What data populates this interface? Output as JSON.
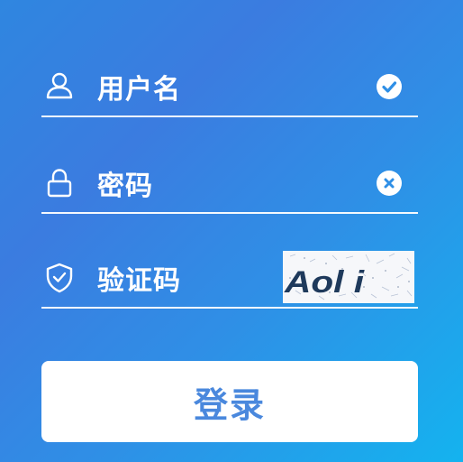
{
  "form": {
    "username": {
      "icon": "user-icon",
      "placeholder": "用户名",
      "status_icon": "check-circle-icon"
    },
    "password": {
      "icon": "lock-icon",
      "placeholder": "密码",
      "status_icon": "clear-circle-icon"
    },
    "captcha": {
      "icon": "shield-check-icon",
      "placeholder": "验证码",
      "image_text": "Aol i"
    },
    "login_label": "登录"
  },
  "colors": {
    "background_start": "#3b7ce0",
    "background_end": "#14b3ef",
    "button_text": "#4a88dd",
    "status_icon": "#2f8fe6"
  }
}
